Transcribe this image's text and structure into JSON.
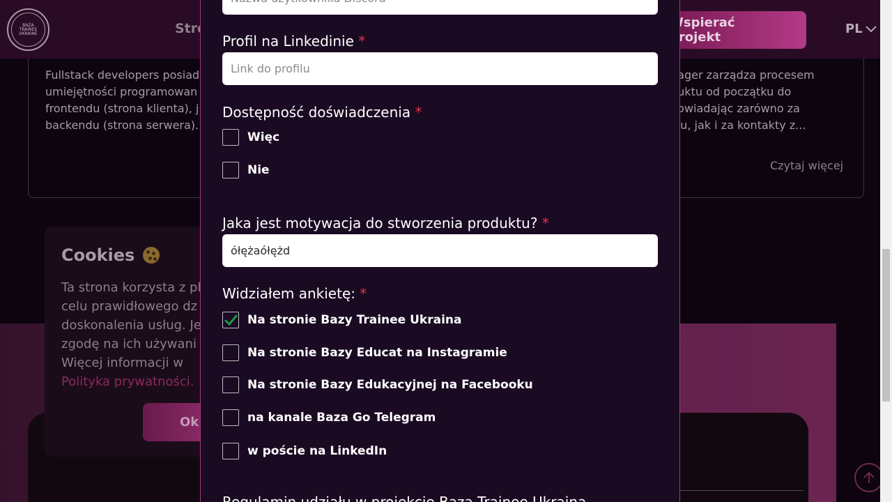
{
  "header": {
    "logo_text": "BAZA\nTRAINEE\nUKRAINE",
    "nav_partial": "Stro",
    "support_button": "Wspierać projekt",
    "language": "PL"
  },
  "cards": {
    "left_text": "Fullstack developers posiad umiejętności programowan frontendu (strona klienta), j backendu (strona serwera).",
    "right_lines": [
      "nager zarządza procesem",
      "duktu od początku do",
      "powiadając zarówno za",
      "olu, jak i za kontakty z..."
    ],
    "read_more": "Czytaj więcej"
  },
  "cookies": {
    "title": "Cookies",
    "lines": [
      "Ta strona korzysta z pl",
      "celu prawidłowego dz",
      "doskonalenia usług. Je",
      "zgodę na ich używani",
      "Więcej informacji w"
    ],
    "policy_link": "Polityka prywatności.",
    "ok_button": "Ok"
  },
  "form": {
    "discord_placeholder": "Nazwa użytkownika Discord",
    "linkedin": {
      "label": "Profil na Linkedinie",
      "required_mark": "*",
      "placeholder": "Link do profilu"
    },
    "experience": {
      "label": "Dostępność doświadczenia",
      "required_mark": "*",
      "options": [
        {
          "label": "Więc",
          "checked": false
        },
        {
          "label": "Nie",
          "checked": false
        }
      ]
    },
    "motivation": {
      "label": "Jaka jest motywacja do stworzenia produktu?",
      "required_mark": "*",
      "value": "ółężaółężd"
    },
    "survey": {
      "label": "Widziałem ankietę:",
      "required_mark": "*",
      "options": [
        {
          "label": "Na stronie Bazy Trainee Ukraina",
          "checked": true
        },
        {
          "label": "Na stronie Bazy Educat na Instagramie",
          "checked": false
        },
        {
          "label": "Na stronie Bazy Edukacyjnej na Facebooku",
          "checked": false
        },
        {
          "label": "na kanale Baza Go Telegram",
          "checked": false
        },
        {
          "label": "w poście na LinkedIn",
          "checked": false
        }
      ]
    },
    "rules_partial": "Regulamin udziału w projekcie Baza Trainee Ukraina"
  },
  "colors": {
    "accent": "#a03a80",
    "required": "#e0334d",
    "check": "#1e9a4a"
  }
}
